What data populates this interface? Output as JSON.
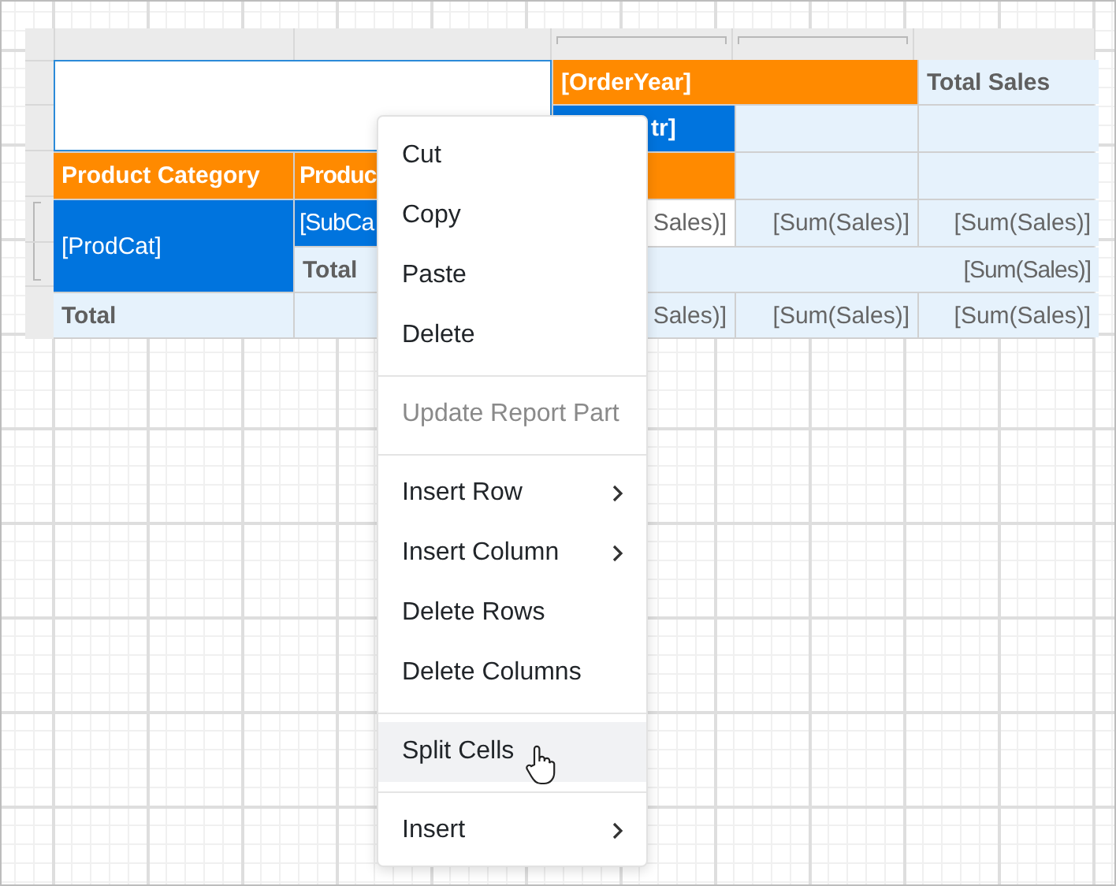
{
  "report_table": {
    "rows": [
      {
        "cells": [
          {
            "kind": "selection",
            "colspan": 2,
            "rowspan": 2
          },
          {
            "kind": "header",
            "text": "[OrderYear]",
            "colspan": 2
          },
          {
            "kind": "total",
            "text": "Total Sales"
          }
        ]
      },
      {
        "cells": [
          {
            "kind": "field",
            "text": "tr]",
            "indent": true
          },
          {
            "kind": "data"
          },
          {
            "kind": "data"
          }
        ]
      },
      {
        "cells": [
          {
            "kind": "header",
            "text": "Product Category"
          },
          {
            "kind": "header",
            "text": "Produc"
          },
          {
            "kind": "header"
          },
          {
            "kind": "data"
          },
          {
            "kind": "data"
          }
        ]
      },
      {
        "cells": [
          {
            "kind": "field",
            "text": "[ProdCat]",
            "rowspan": 2
          },
          {
            "kind": "field",
            "text": "[SubCa"
          },
          {
            "kind": "plain",
            "text": "Sales)]"
          },
          {
            "kind": "value",
            "text": "[Sum(Sales)]"
          },
          {
            "kind": "value",
            "text": "[Sum(Sales)]"
          }
        ]
      },
      {
        "cells": [
          {
            "kind": "total",
            "text": "Total"
          },
          {
            "kind": "value",
            "text": "[Sum(Sales)]",
            "colspan": 3
          }
        ]
      },
      {
        "cells": [
          {
            "kind": "total",
            "text": "Total"
          },
          {
            "kind": "data"
          },
          {
            "kind": "value",
            "text": "Sales)]"
          },
          {
            "kind": "value",
            "text": "[Sum(Sales)]"
          },
          {
            "kind": "value",
            "text": "[Sum(Sales)]"
          }
        ]
      }
    ]
  },
  "context_menu": {
    "items": [
      {
        "kind": "item",
        "label": "Cut",
        "disabled": false,
        "submenu": false,
        "selected": false
      },
      {
        "kind": "item",
        "label": "Copy",
        "disabled": false,
        "submenu": false,
        "selected": false
      },
      {
        "kind": "item",
        "label": "Paste",
        "disabled": false,
        "submenu": false,
        "selected": false
      },
      {
        "kind": "item",
        "label": "Delete",
        "disabled": false,
        "submenu": false,
        "selected": false
      },
      {
        "kind": "separator"
      },
      {
        "kind": "item",
        "label": "Update Report Part",
        "disabled": true,
        "submenu": false,
        "selected": false
      },
      {
        "kind": "separator"
      },
      {
        "kind": "item",
        "label": "Insert Row",
        "disabled": false,
        "submenu": true,
        "selected": false
      },
      {
        "kind": "item",
        "label": "Insert Column",
        "disabled": false,
        "submenu": true,
        "selected": false
      },
      {
        "kind": "item",
        "label": "Delete Rows",
        "disabled": false,
        "submenu": false,
        "selected": false
      },
      {
        "kind": "item",
        "label": "Delete Columns",
        "disabled": false,
        "submenu": false,
        "selected": false
      },
      {
        "kind": "separator"
      },
      {
        "kind": "item",
        "label": "Split Cells",
        "disabled": false,
        "submenu": false,
        "selected": true
      },
      {
        "kind": "separator"
      },
      {
        "kind": "item",
        "label": "Insert",
        "disabled": false,
        "submenu": true,
        "selected": false
      }
    ]
  }
}
